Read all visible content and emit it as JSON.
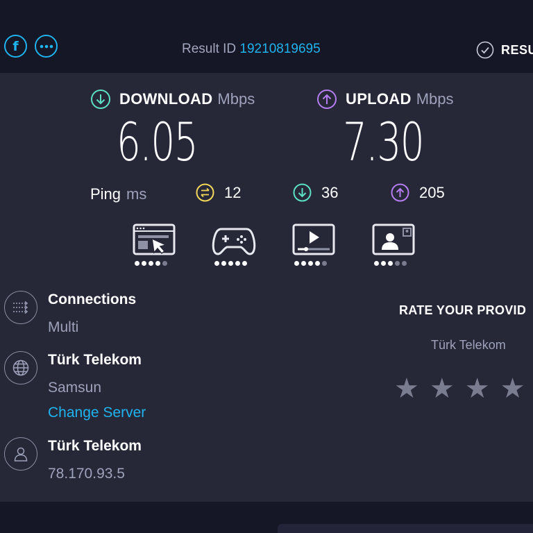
{
  "header": {
    "result_id_label": "Result ID",
    "result_id": "19210819695",
    "results_label": "RESU",
    "facebook_icon": "f",
    "more_icon": "more-icon"
  },
  "download": {
    "label": "DOWNLOAD",
    "unit": "Mbps",
    "value": "6.05",
    "color": "#5ce1c6"
  },
  "upload": {
    "label": "UPLOAD",
    "unit": "Mbps",
    "value": "7.30",
    "color": "#b67df2"
  },
  "ping": {
    "label": "Ping",
    "unit": "ms",
    "idle": "12",
    "download": "36",
    "upload": "205",
    "idle_color": "#f5d85b"
  },
  "quality": [
    {
      "name": "web-browsing",
      "level": 4,
      "max": 5
    },
    {
      "name": "gaming",
      "level": 5,
      "max": 5
    },
    {
      "name": "video-streaming",
      "level": 4,
      "max": 5
    },
    {
      "name": "video-calls",
      "level": 3,
      "max": 5
    }
  ],
  "connections": {
    "title": "Connections",
    "value": "Multi"
  },
  "server": {
    "title": "Türk Telekom",
    "location": "Samsun",
    "change_label": "Change Server"
  },
  "provider": {
    "title": "Türk Telekom",
    "ip": "78.170.93.5"
  },
  "rating": {
    "title": "RATE YOUR PROVID",
    "provider": "Türk Telekom",
    "stars": 4
  },
  "colors": {
    "accent": "#1fb4ef",
    "background": "#262838",
    "topbar": "#151626"
  }
}
